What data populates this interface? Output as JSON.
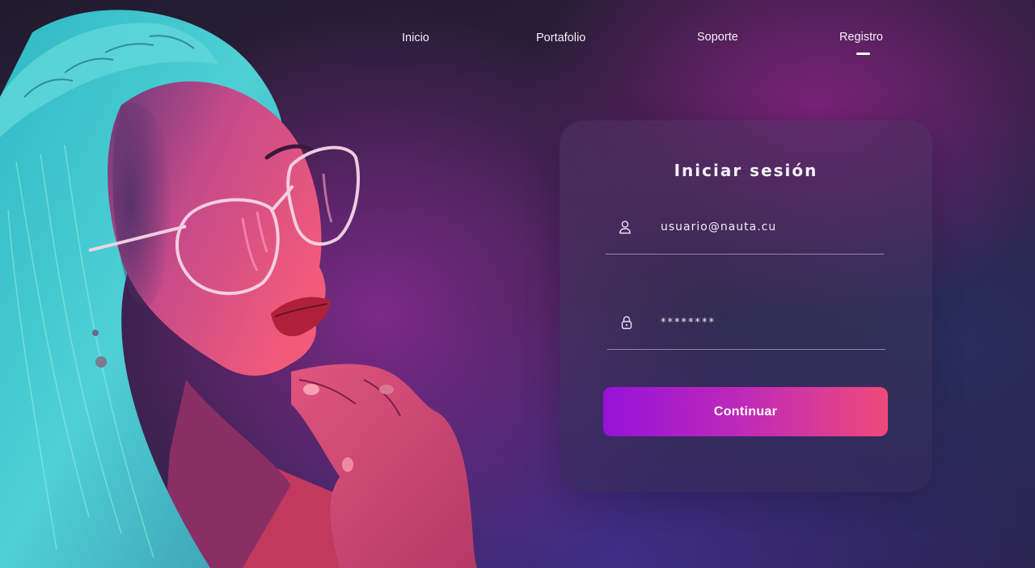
{
  "nav": {
    "items": [
      {
        "label": "Inicio"
      },
      {
        "label": "Portafolio"
      },
      {
        "label": "Soporte"
      },
      {
        "label": "Registro",
        "active": true
      }
    ]
  },
  "login": {
    "title": "Iniciar sesión",
    "username": {
      "value": "usuario@nauta.cu",
      "icon": "user-icon"
    },
    "password": {
      "value": "********",
      "icon": "lock-icon"
    },
    "submit_label": "Continuar"
  },
  "colors": {
    "button_gradient_start": "#9512d8",
    "button_gradient_end": "#ef4a7a",
    "background_dark": "#221b2e",
    "accent_magenta": "#872382"
  }
}
